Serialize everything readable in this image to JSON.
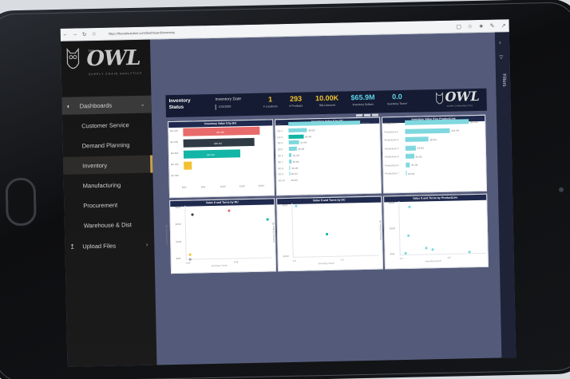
{
  "browser": {
    "url": "https://theowlsolution.com/dashboard/inventory"
  },
  "sidebar": {
    "brand": {
      "name": "OWL",
      "tagline": "SUPPLY CHAIN ANALYTICS",
      "sup": "THE"
    },
    "dashboards_label": "Dashboards",
    "items": [
      {
        "label": "Customer Service"
      },
      {
        "label": "Demand Planning"
      },
      {
        "label": "Inventory"
      },
      {
        "label": "Manufacturing"
      },
      {
        "label": "Procurement"
      },
      {
        "label": "Warehouse & Dist"
      }
    ],
    "upload_label": "Upload Files"
  },
  "filters": {
    "label": "Filters"
  },
  "report": {
    "title": "Inventory Status",
    "date_label": "Inventory Date",
    "date_value": "1/31/2020",
    "kpis": [
      {
        "value": "1",
        "label": "# Locations"
      },
      {
        "value": "293",
        "label": "# Products"
      },
      {
        "value": "10.00K",
        "label": "SKU Amount"
      },
      {
        "value": "$65.9M",
        "label": "Inventory Dollars"
      },
      {
        "value": "0.0",
        "label": "Inventory Turns*"
      }
    ],
    "logo": {
      "name": "OWL",
      "tagline": "SUPPLY CHAIN ANALYTICS"
    },
    "panels": {
      "bu_title": "Inventory Value $ by BU",
      "dc_title": "Inventory Value $ by DC",
      "pl_title": "Inventory Value $ by ProductLine",
      "bu_scatter_title": "Value $ and Turns by BU",
      "dc_scatter_title": "Value $ and Turns by DC",
      "pl_scatter_title": "Value $ and Turns by ProductLine"
    },
    "bu_bars": [
      {
        "label": "BU 100",
        "value": "$21.9M",
        "color": "#e86a6a"
      },
      {
        "label": "BU 200",
        "value": "$20.4M",
        "color": "#2f3a44"
      },
      {
        "label": "BU 300",
        "value": "$16.1M",
        "color": "#13b5a6"
      },
      {
        "label": "BU 400",
        "value": "",
        "color": "#f2c230"
      },
      {
        "label": "BU 500",
        "value": "",
        "color": "#ffffff"
      }
    ],
    "bu_axis": [
      "$0M",
      "$5M",
      "$10M",
      "$15M",
      "$20M"
    ],
    "dc_bars": [
      {
        "label": "DC 1",
        "value": "$30.9M",
        "color": "#7fd8de"
      },
      {
        "label": "DC 2",
        "value": "$8.0M",
        "color": "#7fd8de"
      },
      {
        "label": "DC 3",
        "value": "$6.4M",
        "color": "#13b5a6"
      },
      {
        "label": "DC 4",
        "value": "$4.4M",
        "color": "#7fd8de"
      },
      {
        "label": "DC 5",
        "value": "$3.3M",
        "color": "#7fd8de"
      },
      {
        "label": "DC 6",
        "value": "$1.1M",
        "color": "#7fd8de"
      },
      {
        "label": "DC 7",
        "value": "$0.9M",
        "color": "#7fd8de"
      },
      {
        "label": "DC 8",
        "value": "$0.4M",
        "color": "#7fd8de"
      },
      {
        "label": "DC 9",
        "value": "$0.1M",
        "color": "#7fd8de"
      },
      {
        "label": "DC 10",
        "value": "$0.0M",
        "color": "#7fd8de"
      }
    ],
    "pl_bars": [
      {
        "label": "ProductLine 1",
        "value": "$21.9M",
        "color": "#7fd8de"
      },
      {
        "label": "ProductLine 2",
        "value": "$15.4M",
        "color": "#7fd8de"
      },
      {
        "label": "ProductLine 3",
        "value": "$8.0M",
        "color": "#7fd8de"
      },
      {
        "label": "ProductLine 4",
        "value": "$3.6M",
        "color": "#7fd8de"
      },
      {
        "label": "ProductLine 5",
        "value": "$2.9M",
        "color": "#7fd8de"
      },
      {
        "label": "ProductLine 6",
        "value": "$1.4M",
        "color": "#7fd8de"
      },
      {
        "label": "ProductLine 7",
        "value": "$0.2M",
        "color": "#7fd8de"
      }
    ],
    "bu_scatter": {
      "y_ticks": [
        "$30M",
        "$20M",
        "$10M",
        "$0M"
      ],
      "x_ticks": [
        "0.00",
        "0.05"
      ],
      "ylabel": "Inventory Dollars ($)",
      "xlabel": "Inventory Turns*"
    },
    "dc_scatter": {
      "y_ticks": [
        "$20M",
        "$10M"
      ],
      "x_ticks": [
        "0.0",
        "0.2"
      ],
      "ylabel": "Inventory Dollars ($)",
      "xlabel": "Inventory Turns*"
    },
    "pl_scatter": {
      "y_ticks": [
        "$40M",
        "$20M",
        "$0M"
      ],
      "x_ticks": [
        "0.0",
        "0.5"
      ],
      "ylabel": "Inventory Dollars ($)",
      "xlabel": "Inventory Turns*"
    }
  }
}
